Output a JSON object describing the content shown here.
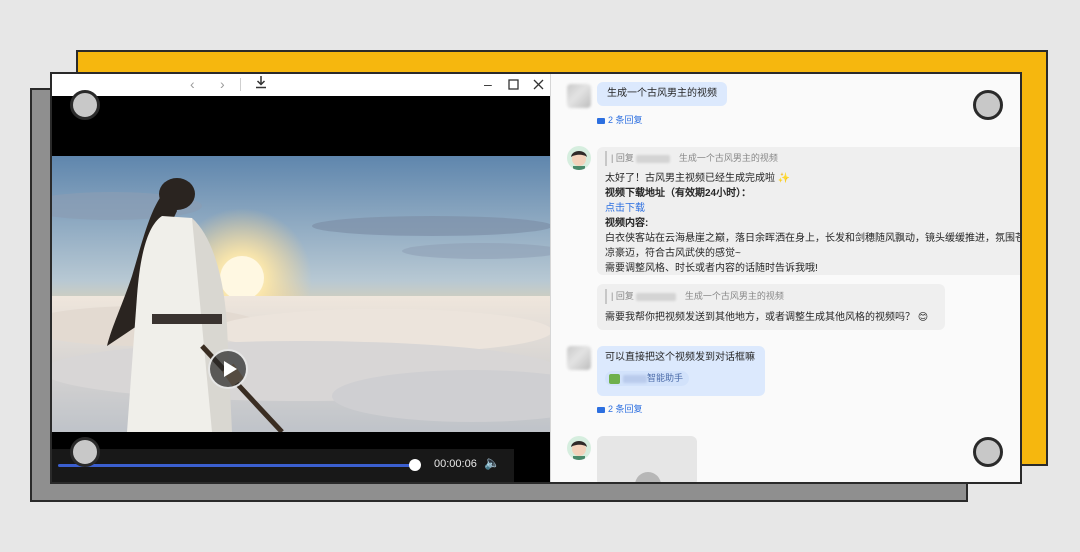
{
  "player": {
    "time": "00:00:06",
    "progress": 0.97,
    "icons": [
      "back-arrow-icon",
      "forward-arrow-icon",
      "download-icon",
      "minimize-icon",
      "maximize-icon",
      "close-icon",
      "play-icon",
      "volume-icon"
    ]
  },
  "chat": {
    "msg1": {
      "text": "生成一个古风男主的视频"
    },
    "reply1": {
      "text": "2 条回复"
    },
    "msg2": {
      "quote_prefix": "| 回复",
      "quote_text": "生成一个古风男主的视频",
      "line1": "太好了！古风男主视频已经生成完成啦 ✨",
      "line2": "视频下载地址（有效期24小时）：",
      "link": "点击下载",
      "line3": "视频内容:",
      "line4": "白衣侠客站在云海悬崖之巅，落日余晖洒在身上，长发和剑穗随风飘动，镜头缓缓推进，氛围苍",
      "line5": "凉豪迈，符合古风武侠的感觉~",
      "line6": "需要调整风格、时长或者内容的话随时告诉我哦!"
    },
    "msg3": {
      "quote_prefix": "| 回复",
      "quote_text": "生成一个古风男主的视频",
      "text": "需要我帮你把视频发送到其他地方，或者调整生成其他风格的视频吗？ 😊"
    },
    "msg4": {
      "text": "可以直接把这个视频发到对话框嘛",
      "chip": "智能助手"
    },
    "reply2": {
      "text": "2 条回复"
    }
  },
  "colors": {
    "accent": "#2c6fe0",
    "yellow": "#f6b70e",
    "user_bubble": "#dce9fd"
  }
}
